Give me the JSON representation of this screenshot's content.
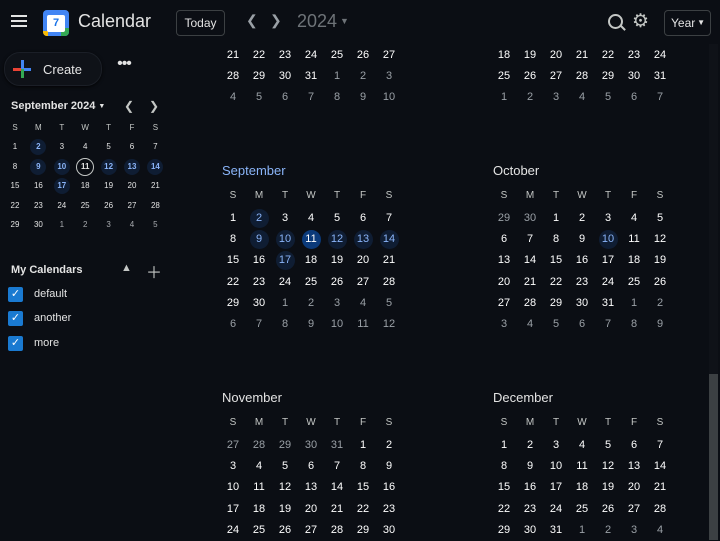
{
  "header": {
    "app_title": "Calendar",
    "logo_text": "7",
    "today_label": "Today",
    "prev_icon": "chevron-left-icon",
    "next_icon": "chevron-right-icon",
    "year": "2024",
    "view_label": "Year"
  },
  "sidebar": {
    "create_label": "Create",
    "more_label": "•••",
    "mini_calendar": {
      "title": "September 2024",
      "weekdays": [
        "S",
        "M",
        "T",
        "W",
        "T",
        "F",
        "S"
      ],
      "weeks": [
        [
          "1",
          "2",
          "3",
          "4",
          "5",
          "6",
          "7"
        ],
        [
          "8",
          "9",
          "10",
          "11",
          "12",
          "13",
          "14"
        ],
        [
          "15",
          "16",
          "17",
          "18",
          "19",
          "20",
          "21"
        ],
        [
          "22",
          "23",
          "24",
          "25",
          "26",
          "27",
          "28"
        ],
        [
          "29",
          "30",
          "1",
          "2",
          "3",
          "4",
          "5"
        ]
      ]
    },
    "my_calendars_title": "My Calendars",
    "calendars": [
      "default",
      "another",
      "more"
    ]
  },
  "year_view": {
    "weekdays": [
      "S",
      "M",
      "T",
      "W",
      "T",
      "F",
      "S"
    ],
    "partial_top_left": [
      [
        "21",
        "22",
        "23",
        "24",
        "25",
        "26",
        "27"
      ],
      [
        "28",
        "29",
        "30",
        "31",
        "1",
        "2",
        "3"
      ],
      [
        "4",
        "5",
        "6",
        "7",
        "8",
        "9",
        "10"
      ]
    ],
    "partial_top_right": [
      [
        "18",
        "19",
        "20",
        "21",
        "22",
        "23",
        "24"
      ],
      [
        "25",
        "26",
        "27",
        "28",
        "29",
        "30",
        "31"
      ],
      [
        "1",
        "2",
        "3",
        "4",
        "5",
        "6",
        "7"
      ]
    ],
    "months": [
      {
        "name": "September",
        "current": true,
        "weeks": [
          [
            "1",
            "2",
            "3",
            "4",
            "5",
            "6",
            "7"
          ],
          [
            "8",
            "9",
            "10",
            "11",
            "12",
            "13",
            "14"
          ],
          [
            "15",
            "16",
            "17",
            "18",
            "19",
            "20",
            "21"
          ],
          [
            "22",
            "23",
            "24",
            "25",
            "26",
            "27",
            "28"
          ],
          [
            "29",
            "30",
            "1",
            "2",
            "3",
            "4",
            "5"
          ],
          [
            "6",
            "7",
            "8",
            "9",
            "10",
            "11",
            "12"
          ]
        ]
      },
      {
        "name": "October",
        "current": false,
        "weeks": [
          [
            "29",
            "30",
            "1",
            "2",
            "3",
            "4",
            "5"
          ],
          [
            "6",
            "7",
            "8",
            "9",
            "10",
            "11",
            "12"
          ],
          [
            "13",
            "14",
            "15",
            "16",
            "17",
            "18",
            "19"
          ],
          [
            "20",
            "21",
            "22",
            "23",
            "24",
            "25",
            "26"
          ],
          [
            "27",
            "28",
            "29",
            "30",
            "31",
            "1",
            "2"
          ],
          [
            "3",
            "4",
            "5",
            "6",
            "7",
            "8",
            "9"
          ]
        ]
      },
      {
        "name": "November",
        "current": false,
        "weeks": [
          [
            "27",
            "28",
            "29",
            "30",
            "31",
            "1",
            "2"
          ],
          [
            "3",
            "4",
            "5",
            "6",
            "7",
            "8",
            "9"
          ],
          [
            "10",
            "11",
            "12",
            "13",
            "14",
            "15",
            "16"
          ],
          [
            "17",
            "18",
            "19",
            "20",
            "21",
            "22",
            "23"
          ],
          [
            "24",
            "25",
            "26",
            "27",
            "28",
            "29",
            "30"
          ]
        ]
      },
      {
        "name": "December",
        "current": false,
        "weeks": [
          [
            "1",
            "2",
            "3",
            "4",
            "5",
            "6",
            "7"
          ],
          [
            "8",
            "9",
            "10",
            "11",
            "12",
            "13",
            "14"
          ],
          [
            "15",
            "16",
            "17",
            "18",
            "19",
            "20",
            "21"
          ],
          [
            "22",
            "23",
            "24",
            "25",
            "26",
            "27",
            "28"
          ],
          [
            "29",
            "30",
            "31",
            "1",
            "2",
            "3",
            "4"
          ]
        ]
      }
    ]
  }
}
